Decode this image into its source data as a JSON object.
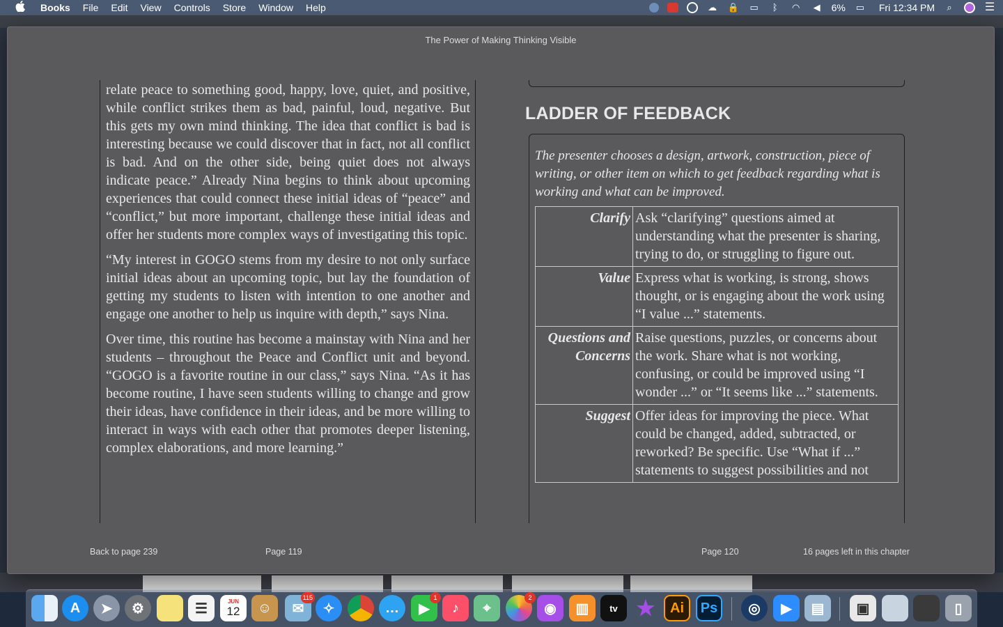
{
  "menubar": {
    "apple_icon": "",
    "items": [
      "Books",
      "File",
      "Edit",
      "View",
      "Controls",
      "Store",
      "Window",
      "Help"
    ],
    "battery": "6%",
    "clock": "Fri 12:34 PM"
  },
  "window": {
    "title": "The Power of Making Thinking Visible"
  },
  "left_page": {
    "paragraphs": [
      "relate peace to something good, happy, love, quiet, and positive, while conflict strikes them as bad, painful, loud, negative. But this gets my own mind thinking. The idea that conflict is bad is interesting because we could discover that in fact, not all conflict is bad. And on the other side, being quiet does not always indicate peace.” Already Nina begins to think about upcoming experiences that could connect these initial ideas of “peace” and “conflict,” but more important, challenge these initial ideas and offer her students more complex ways of investigating this topic.",
      "“My interest in GOGO stems from my desire to not only surface initial ideas about an upcoming topic, but lay the foundation of getting my students to listen with intention to one another and engage one another to help us inquire with depth,” says Nina.",
      "Over time, this routine has become a mainstay with Nina and her students – throughout the Peace and Conflict unit and beyond. “GOGO is a favorite routine in our class,” says Nina. “As it has become routine, I have seen students willing to change and grow their ideas, have confidence in their ideas, and be more willing to interact in ways with each other that promotes deeper listening, complex elaborations, and more learning.”"
    ]
  },
  "right_page": {
    "heading": "LADDER OF FEEDBACK",
    "intro": "The presenter chooses a design, artwork, construction, piece of writing, or other item on which to get feedback regarding what is working and what can be improved.",
    "steps": [
      {
        "term": "Clarify",
        "description": "Ask “clarifying” questions aimed at understanding what the presenter is sharing, trying to do, or struggling to figure out."
      },
      {
        "term": "Value",
        "description": "Express what is working, is strong, shows thought, or is engaging about the work using “I value ...” statements."
      },
      {
        "term": "Questions and Concerns",
        "description": "Raise questions, puzzles, or concerns about the work. Share what is not working, confusing, or could be improved using “I wonder ...” or “It seems like ...” statements."
      },
      {
        "term": "Suggest",
        "description": "Offer ideas for improving the piece. What could be changed, added, subtracted, or reworked? Be specific. Use “What if ...” statements to suggest possibilities and not"
      }
    ]
  },
  "footer": {
    "back_link": "Back to page 239",
    "left_page_number": "Page 119",
    "right_page_number": "Page 120",
    "pages_left": "16 pages left in this chapter"
  },
  "dock": {
    "calendar_month": "JUN",
    "calendar_day": "12",
    "mail_badge": "115",
    "facetime_badge": "1",
    "photos_badge": "2",
    "tv_label": "tv",
    "illustrator_label": "Ai",
    "photoshop_label": "Ps"
  }
}
